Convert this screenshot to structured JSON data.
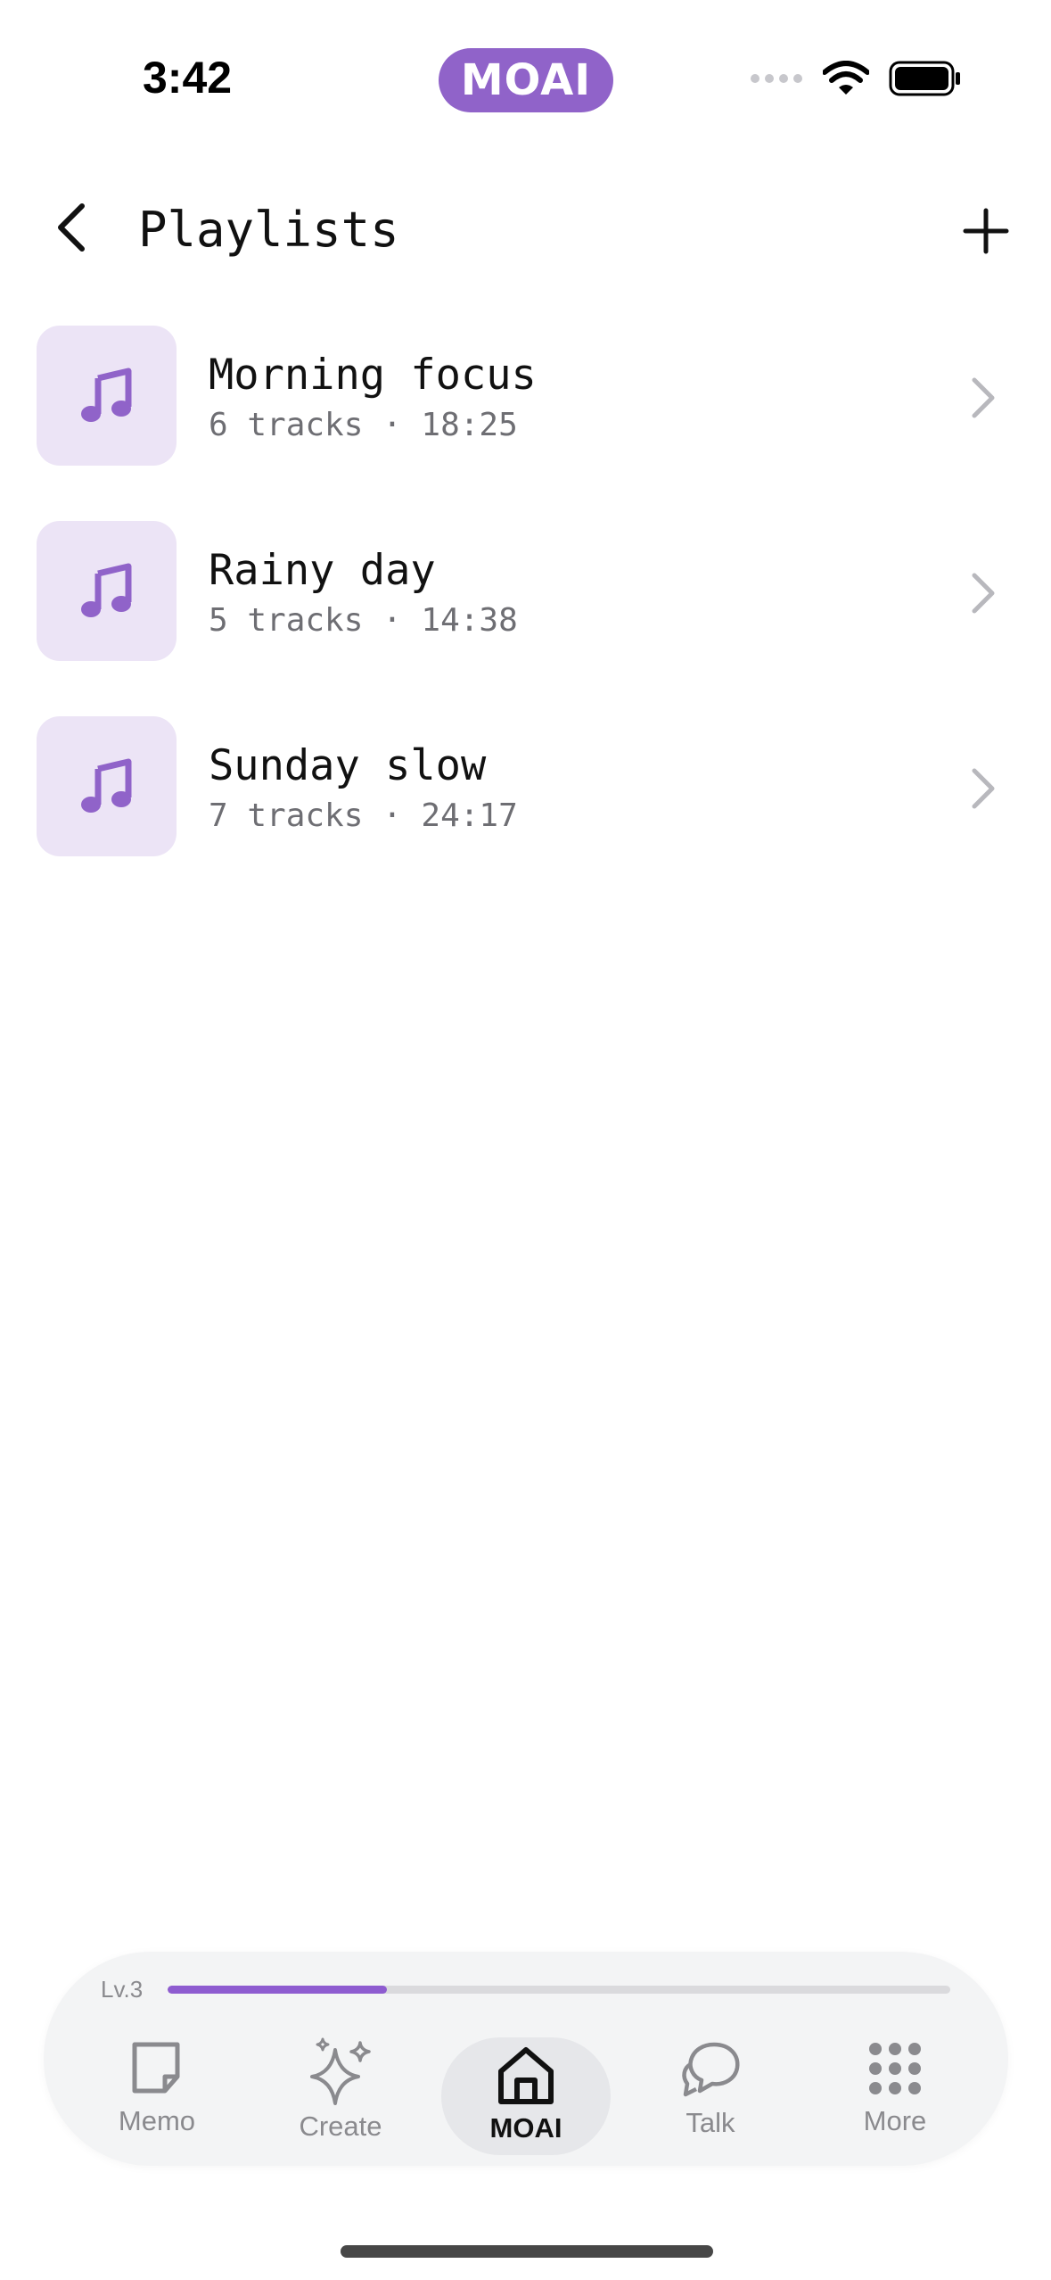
{
  "status_bar": {
    "time": "3:42",
    "app_badge": "MOAI"
  },
  "header": {
    "title": "Playlists",
    "back_icon": "chevron-left-icon",
    "add_icon": "plus-icon"
  },
  "playlists": [
    {
      "title": "Morning focus",
      "subtitle": "6 tracks · 18:25"
    },
    {
      "title": "Rainy day",
      "subtitle": "5 tracks · 14:38"
    },
    {
      "title": "Sunday slow",
      "subtitle": "7 tracks · 24:17"
    }
  ],
  "bottom_nav": {
    "level_label": "Lv.3",
    "level_progress": 0.28,
    "tabs": [
      {
        "label": "Memo",
        "icon": "memo-icon"
      },
      {
        "label": "Create",
        "icon": "sparkles-icon"
      },
      {
        "label": "MOAI",
        "icon": "home-icon",
        "active": true
      },
      {
        "label": "Talk",
        "icon": "chat-icon"
      },
      {
        "label": "More",
        "icon": "grid-icon"
      }
    ]
  },
  "colors": {
    "accent": "#9063c9",
    "thumb_bg": "#ece4f6",
    "muted_text": "#6e6e73"
  }
}
